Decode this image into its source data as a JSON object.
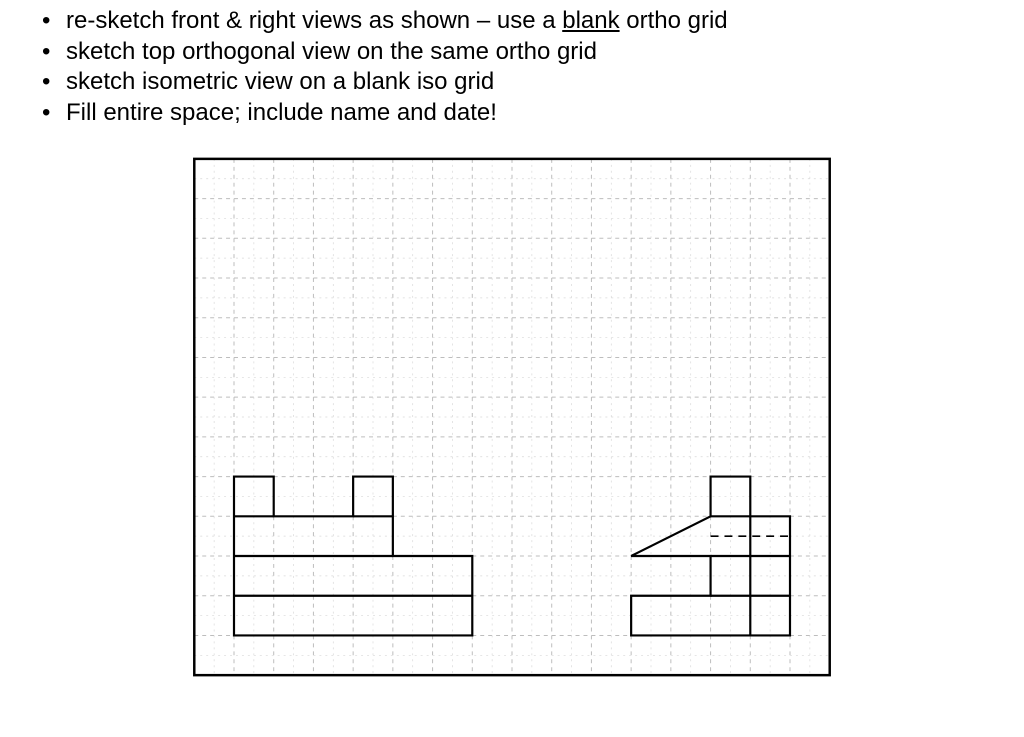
{
  "instructions": {
    "item1_pre": "re-sketch front & right views as shown – use a ",
    "item1_underlined": "blank",
    "item1_post": " ortho grid",
    "item2": "sketch top orthogonal view on the same ortho grid",
    "item3": "sketch isometric view on a blank iso grid",
    "item4": "Fill entire space; include name and date!"
  },
  "figure": {
    "grid_cols": 16,
    "grid_rows": 13,
    "views_present": [
      "front",
      "right"
    ],
    "views_to_add": [
      "top",
      "isometric"
    ]
  }
}
